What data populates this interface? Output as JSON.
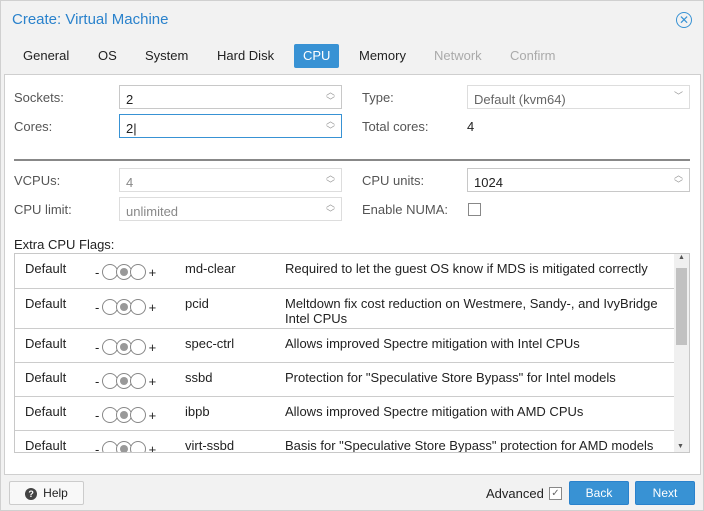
{
  "title": "Create: Virtual Machine",
  "tabs": [
    "General",
    "OS",
    "System",
    "Hard Disk",
    "CPU",
    "Memory",
    "Network",
    "Confirm"
  ],
  "form": {
    "sockets_label": "Sockets:",
    "sockets": "2",
    "cores_label": "Cores:",
    "cores": "2",
    "type_label": "Type:",
    "type": "Default (kvm64)",
    "total_label": "Total cores:",
    "total": "4",
    "vcpus_label": "VCPUs:",
    "vcpus": "4",
    "units_label": "CPU units:",
    "units": "1024",
    "limit_label": "CPU limit:",
    "limit": "unlimited",
    "numa_label": "Enable NUMA:"
  },
  "flags_label": "Extra CPU Flags:",
  "flags": [
    {
      "state": "Default",
      "name": "md-clear",
      "desc": "Required to let the guest OS know if MDS is mitigated correctly"
    },
    {
      "state": "Default",
      "name": "pcid",
      "desc": "Meltdown fix cost reduction on Westmere, Sandy-, and IvyBridge Intel CPUs"
    },
    {
      "state": "Default",
      "name": "spec-ctrl",
      "desc": "Allows improved Spectre mitigation with Intel CPUs"
    },
    {
      "state": "Default",
      "name": "ssbd",
      "desc": "Protection for \"Speculative Store Bypass\" for Intel models"
    },
    {
      "state": "Default",
      "name": "ibpb",
      "desc": "Allows improved Spectre mitigation with AMD CPUs"
    },
    {
      "state": "Default",
      "name": "virt-ssbd",
      "desc": "Basis for \"Speculative Store Bypass\" protection for AMD models"
    }
  ],
  "footer": {
    "help": "Help",
    "advanced": "Advanced",
    "back": "Back",
    "next": "Next"
  }
}
